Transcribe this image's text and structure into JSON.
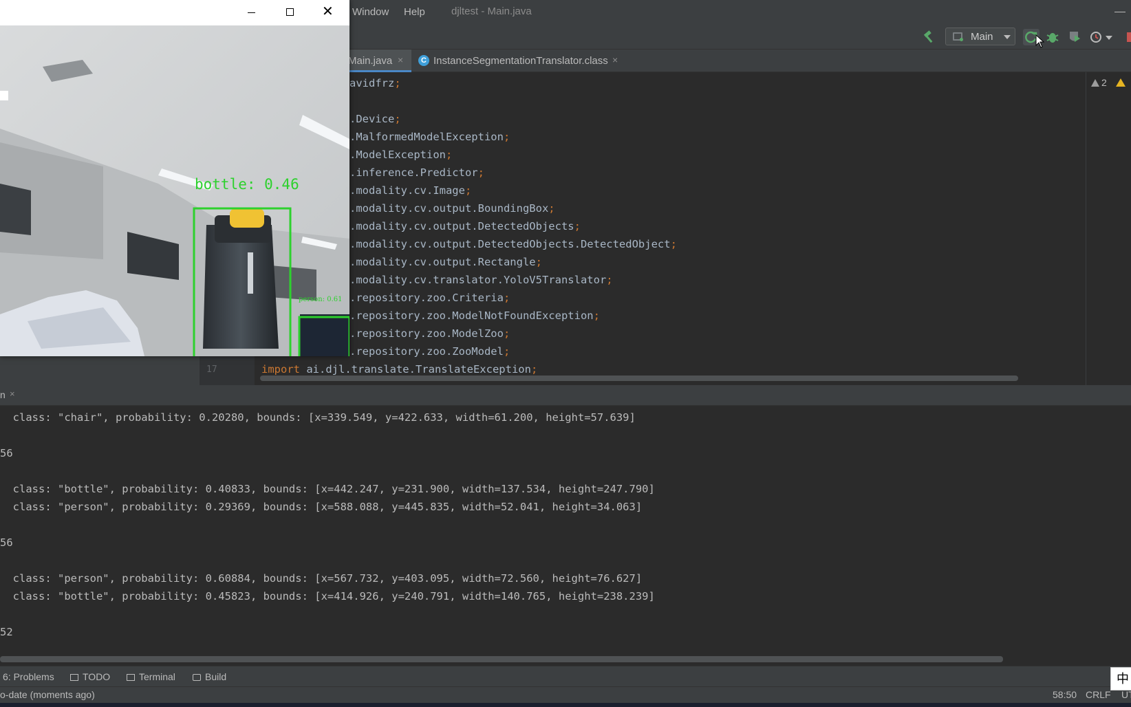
{
  "menu": {
    "window_label": "Window",
    "help_label": "Help"
  },
  "project_title": "djltest - Main.java",
  "run_config": {
    "label": "Main"
  },
  "tabs": [
    {
      "label": "Main.java",
      "close": "×"
    },
    {
      "label": "InstanceSegmentationTranslator.class",
      "icon_letter": "C",
      "close": "×"
    }
  ],
  "editor": {
    "warnings": {
      "count": "2"
    },
    "lines": [
      {
        "num": "",
        "keyword": "",
        "text": "avidfrz",
        "semi": ";"
      },
      {
        "num": "",
        "keyword": "",
        "text": "",
        "semi": ""
      },
      {
        "num": "",
        "keyword": "",
        "text": ".Device",
        "semi": ";"
      },
      {
        "num": "",
        "keyword": "",
        "text": ".MalformedModelException",
        "semi": ";"
      },
      {
        "num": "",
        "keyword": "",
        "text": ".ModelException",
        "semi": ";"
      },
      {
        "num": "",
        "keyword": "",
        "text": ".inference.Predictor",
        "semi": ";"
      },
      {
        "num": "",
        "keyword": "",
        "text": ".modality.cv.Image",
        "semi": ";"
      },
      {
        "num": "",
        "keyword": "",
        "text": ".modality.cv.output.BoundingBox",
        "semi": ";"
      },
      {
        "num": "",
        "keyword": "",
        "text": ".modality.cv.output.DetectedObjects",
        "semi": ";"
      },
      {
        "num": "",
        "keyword": "",
        "text": ".modality.cv.output.DetectedObjects.DetectedObject",
        "semi": ";"
      },
      {
        "num": "",
        "keyword": "",
        "text": ".modality.cv.output.Rectangle",
        "semi": ";"
      },
      {
        "num": "",
        "keyword": "",
        "text": ".modality.cv.translator.YoloV5Translator",
        "semi": ";"
      },
      {
        "num": "",
        "keyword": "",
        "text": ".repository.zoo.Criteria",
        "semi": ";"
      },
      {
        "num": "",
        "keyword": "",
        "text": ".repository.zoo.ModelNotFoundException",
        "semi": ";"
      },
      {
        "num": "",
        "keyword": "",
        "text": ".repository.zoo.ModelZoo",
        "semi": ";"
      },
      {
        "num": "",
        "keyword": "",
        "text": ".repository.zoo.ZooModel",
        "semi": ";"
      },
      {
        "num": "17",
        "keyword": "import",
        "text": " ai.djl.translate.TranslateException",
        "semi": ";"
      }
    ]
  },
  "run_panel": {
    "tab_label": "n",
    "close": "×"
  },
  "console": {
    "lines": [
      "  class: \"chair\", probability: 0.20280, bounds: [x=339.549, y=422.633, width=61.200, height=57.639]",
      "",
      "56",
      "",
      "  class: \"bottle\", probability: 0.40833, bounds: [x=442.247, y=231.900, width=137.534, height=247.790]",
      "  class: \"person\", probability: 0.29369, bounds: [x=588.088, y=445.835, width=52.041, height=34.063]",
      "",
      "56",
      "",
      "  class: \"person\", probability: 0.60884, bounds: [x=567.732, y=403.095, width=72.560, height=76.627]",
      "  class: \"bottle\", probability: 0.45823, bounds: [x=414.926, y=240.791, width=140.765, height=238.239]",
      "",
      "52"
    ]
  },
  "bottom_tools": [
    {
      "label": "6: Problems"
    },
    {
      "label": "TODO"
    },
    {
      "label": "Terminal"
    },
    {
      "label": "Build"
    }
  ],
  "status": {
    "message": "o-date (moments ago)",
    "position": "58:50",
    "line_sep": "CRLF",
    "encoding": "UT"
  },
  "ime": "中",
  "camera": {
    "detections": [
      {
        "label": "bottle: 0.46"
      },
      {
        "label": "person: 0.61"
      }
    ]
  },
  "icons": {
    "hammer": "hammer-icon",
    "rerun": "rerun-icon",
    "debug": "debug-icon",
    "coverage": "coverage-icon",
    "profile": "profile-icon",
    "stop": "stop-icon"
  },
  "colors": {
    "ide_bg": "#2b2b2b",
    "panel_bg": "#3c3f41",
    "keyword": "#cc7832",
    "code_text": "#a9b7c6",
    "detection_box": "#2dd12d",
    "accent_run": "#59a869"
  }
}
